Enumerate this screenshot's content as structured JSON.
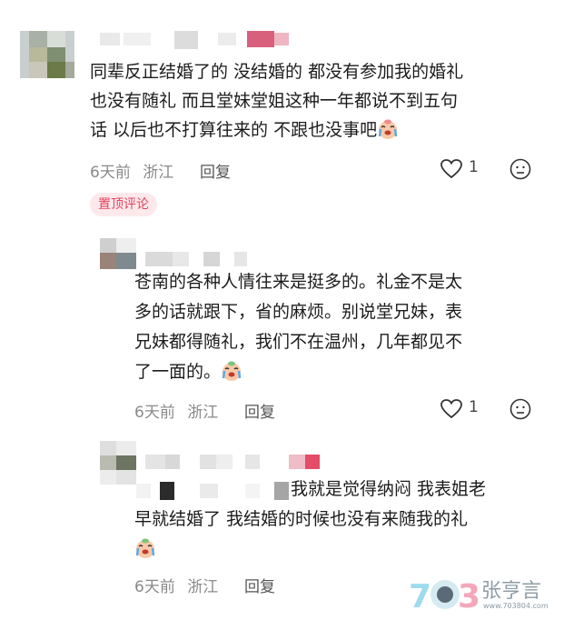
{
  "comments": [
    {
      "text_lines": [
        "同辈反正结婚了的 没结婚的 都没有参加我的婚礼",
        "也没有随礼  而且堂妹堂姐这种一年都说不到五句",
        "话 以后也不打算往来的 不跟也没事吧"
      ],
      "emoji_icon": "loudly-crying-face-icon",
      "time": "6天前",
      "location": "浙江",
      "reply_label": "回复",
      "likes": "1",
      "badge": "置顶评论"
    },
    {
      "text_lines": [
        "苍南的各种人情往来是挺多的。礼金不是太",
        "多的话就跟下，省的麻烦。别说堂兄妹，表",
        "兄妹都得随礼，我们不在温州，几年都见不",
        "了一面的。"
      ],
      "emoji_icon": "loudly-crying-face-icon",
      "time": "6天前",
      "location": "浙江",
      "reply_label": "回复",
      "likes": "1"
    },
    {
      "text_lines": [
        "我就是觉得纳闷 我表姐老",
        "早就结婚了 我结婚的时候也没有来随我的礼"
      ],
      "emoji_icon": "loudly-crying-face-icon",
      "time": "6天前",
      "location": "浙江",
      "reply_label": "回复"
    }
  ],
  "watermark": {
    "brand": "张亨言",
    "site": "www.703804.com",
    "logo_text": "703"
  },
  "colors": {
    "accent": "#e0455f",
    "meta": "#8a8a8a",
    "badge_bg": "#fde9ec"
  }
}
